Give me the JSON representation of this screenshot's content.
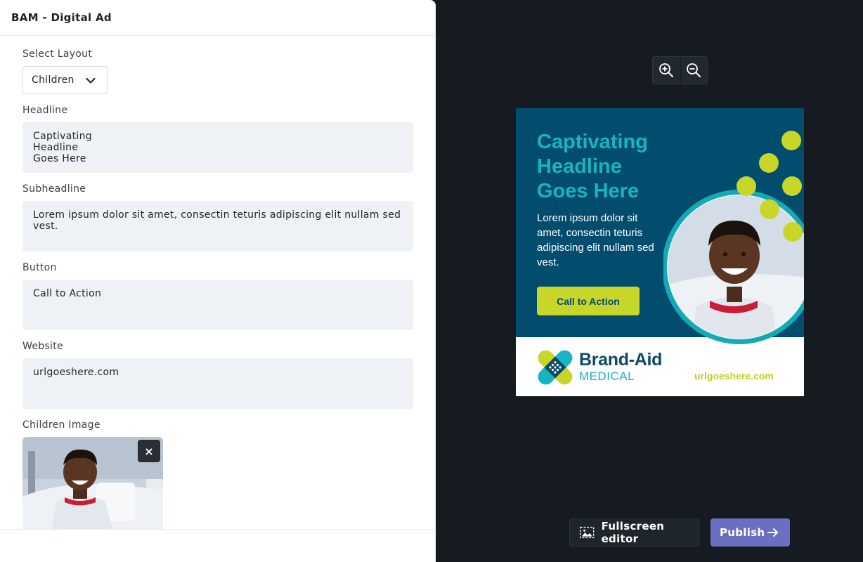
{
  "panel": {
    "title": "BAM - Digital Ad"
  },
  "form": {
    "layout": {
      "label": "Select Layout",
      "value": "Children"
    },
    "headline": {
      "label": "Headline",
      "value": "Captivating\nHeadline\nGoes Here"
    },
    "subheadline": {
      "label": "Subheadline",
      "value": "Lorem ipsum dolor sit amet, consectin teturis adipiscing elit nullam sed vest."
    },
    "button": {
      "label": "Button",
      "value": "Call to Action"
    },
    "website": {
      "label": "Website",
      "value": "urlgoeshere.com"
    },
    "image": {
      "label": "Children Image",
      "remove_label": "×"
    }
  },
  "preview": {
    "headline": "Captivating\nHeadline\nGoes Here",
    "subheadline": "Lorem ipsum dolor sit amet, consectin teturis adipiscing elit nullam sed vest.",
    "cta": "Call to Action",
    "brand_name": "Brand-Aid",
    "brand_sub": "MEDICAL",
    "url": "urlgoeshere.com",
    "colors": {
      "primary": "#024c6e",
      "teal": "#17b5c1",
      "lime": "#c8d62a"
    }
  },
  "toolbar": {
    "zoom_in_icon": "zoom-in-icon",
    "zoom_out_icon": "zoom-out-icon",
    "fullscreen_label": "Fullscreen editor",
    "publish_label": "Publish"
  }
}
